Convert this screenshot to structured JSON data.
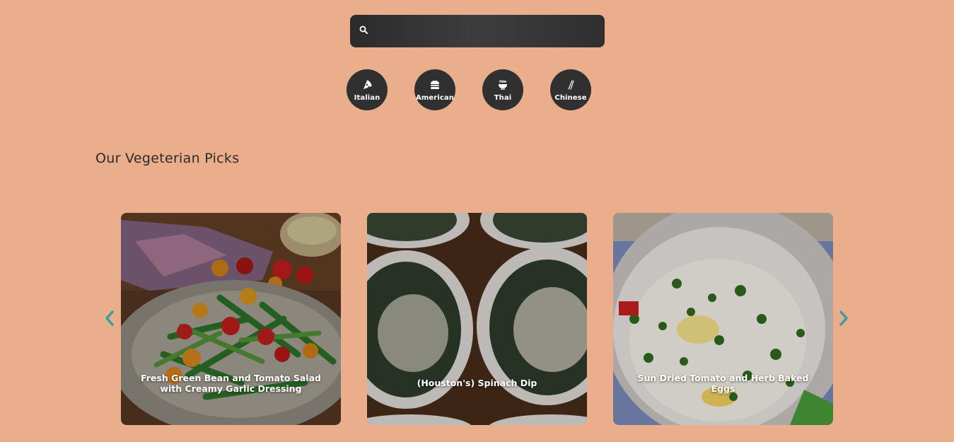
{
  "search": {
    "value": "",
    "placeholder": ""
  },
  "categories": [
    {
      "label": "Italian",
      "icon": "pizza-icon"
    },
    {
      "label": "American",
      "icon": "burger-icon"
    },
    {
      "label": "Thai",
      "icon": "noodle-bowl-icon"
    },
    {
      "label": "Chinese",
      "icon": "chopsticks-icon"
    }
  ],
  "section": {
    "title": "Our Vegeterian Picks"
  },
  "carousel": {
    "cards": [
      {
        "title": "Fresh Green Bean and Tomato Salad with Creamy Garlic Dressing"
      },
      {
        "title": "(Houston's) Spinach Dip"
      },
      {
        "title": "Sun Dried Tomato and Herb Baked Eggs"
      }
    ]
  },
  "colors": {
    "background": "#ebae8c",
    "search_bar": "#333333",
    "category_circle": "#303030",
    "arrow": "#3a9ea1"
  }
}
